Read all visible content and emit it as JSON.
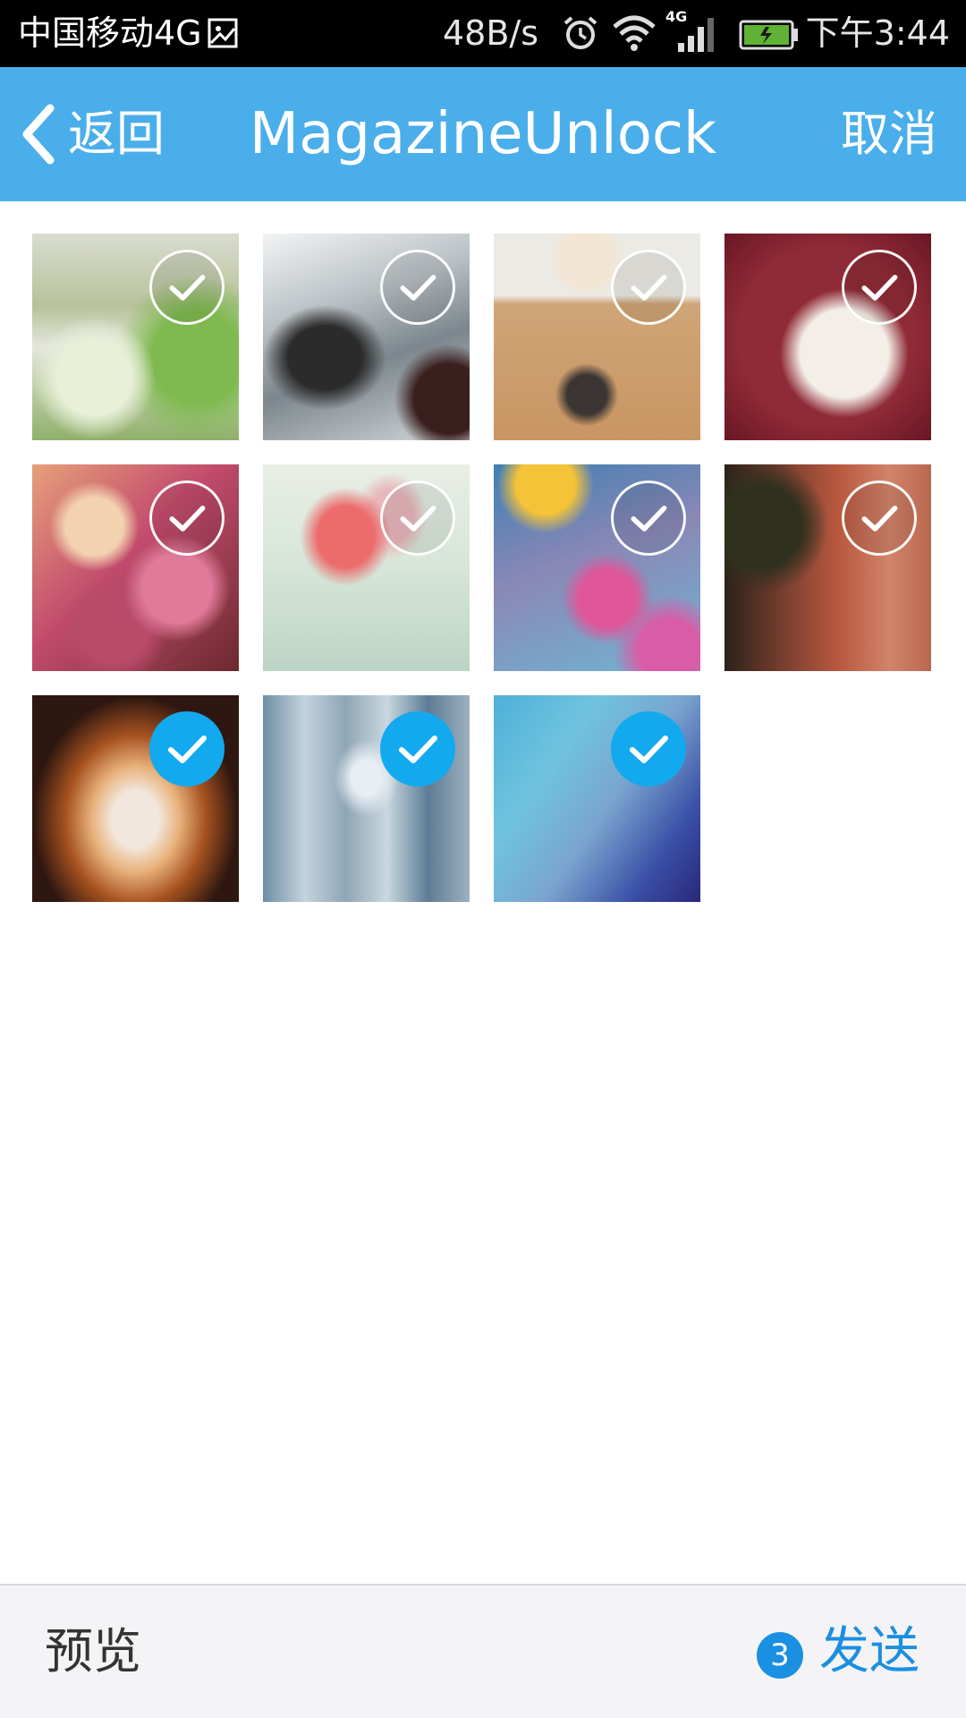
{
  "status_bar": {
    "carrier": "中国移动4G",
    "network_speed": "48B/s",
    "network_type": "4G",
    "time": "下午3:44",
    "icons": [
      "image-notification-icon",
      "alarm-icon",
      "wifi-icon",
      "signal-icon",
      "battery-icon"
    ]
  },
  "title_bar": {
    "back_label": "返回",
    "title": "MagazineUnlock",
    "cancel_label": "取消",
    "accent_color": "#4aaeea"
  },
  "photos": [
    {
      "name": "photo-garden-stairs",
      "selected": false
    },
    {
      "name": "photo-car",
      "selected": false
    },
    {
      "name": "photo-kitten-box",
      "selected": false
    },
    {
      "name": "photo-puppy",
      "selected": false
    },
    {
      "name": "photo-flowers-pink",
      "selected": false
    },
    {
      "name": "photo-tulips",
      "selected": false
    },
    {
      "name": "photo-colorful-flowers",
      "selected": false
    },
    {
      "name": "photo-old-street",
      "selected": false
    },
    {
      "name": "photo-spiral-staircase",
      "selected": true
    },
    {
      "name": "photo-glass-corridor",
      "selected": true
    },
    {
      "name": "photo-blue-abstract",
      "selected": true
    }
  ],
  "bottom_bar": {
    "preview_label": "预览",
    "selected_count": "3",
    "send_label": "发送",
    "send_color": "#1b8fe1"
  }
}
